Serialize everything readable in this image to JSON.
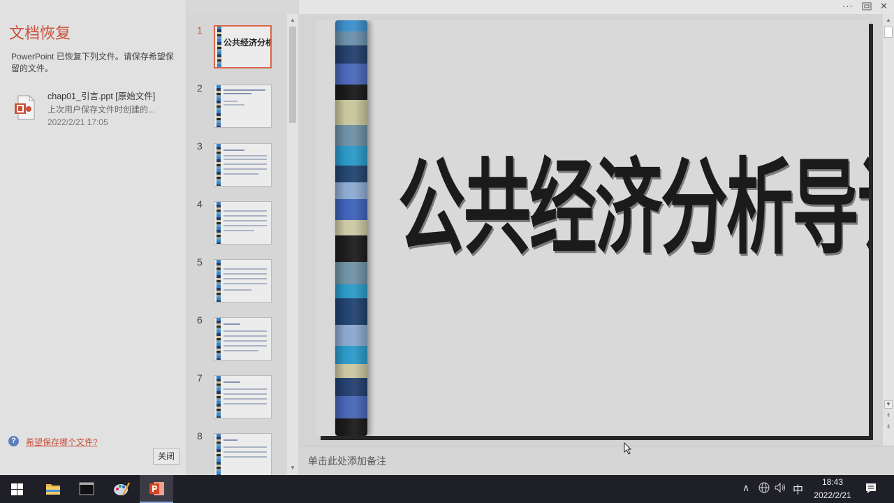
{
  "recovery": {
    "title": "文档恢复",
    "description": "PowerPoint 已恢复下列文件。请保存希望保留的文件。",
    "file": {
      "name": "chap01_引言.ppt  [原始文件]",
      "subtitle": "上次用户保存文件时创建的...",
      "date": "2022/2/21 17:05"
    },
    "help_link": "希望保存哪个文件?",
    "close_label": "关闭"
  },
  "thumbnails": {
    "numbers": [
      "1",
      "2",
      "3",
      "4",
      "5",
      "6",
      "7",
      "8"
    ],
    "selected": "1",
    "slide1_title": "公共经济分析导论"
  },
  "slide": {
    "title": "公共经济分析导论"
  },
  "notes": {
    "placeholder": "单击此处添加备注"
  },
  "window": {
    "more": "···"
  },
  "taskbar": {
    "ime": "中",
    "time": "18:43",
    "date": "2022/2/21"
  },
  "colors": {
    "accent": "#c9513b",
    "selection": "#d9644a",
    "taskbar": "#1e1f27"
  }
}
